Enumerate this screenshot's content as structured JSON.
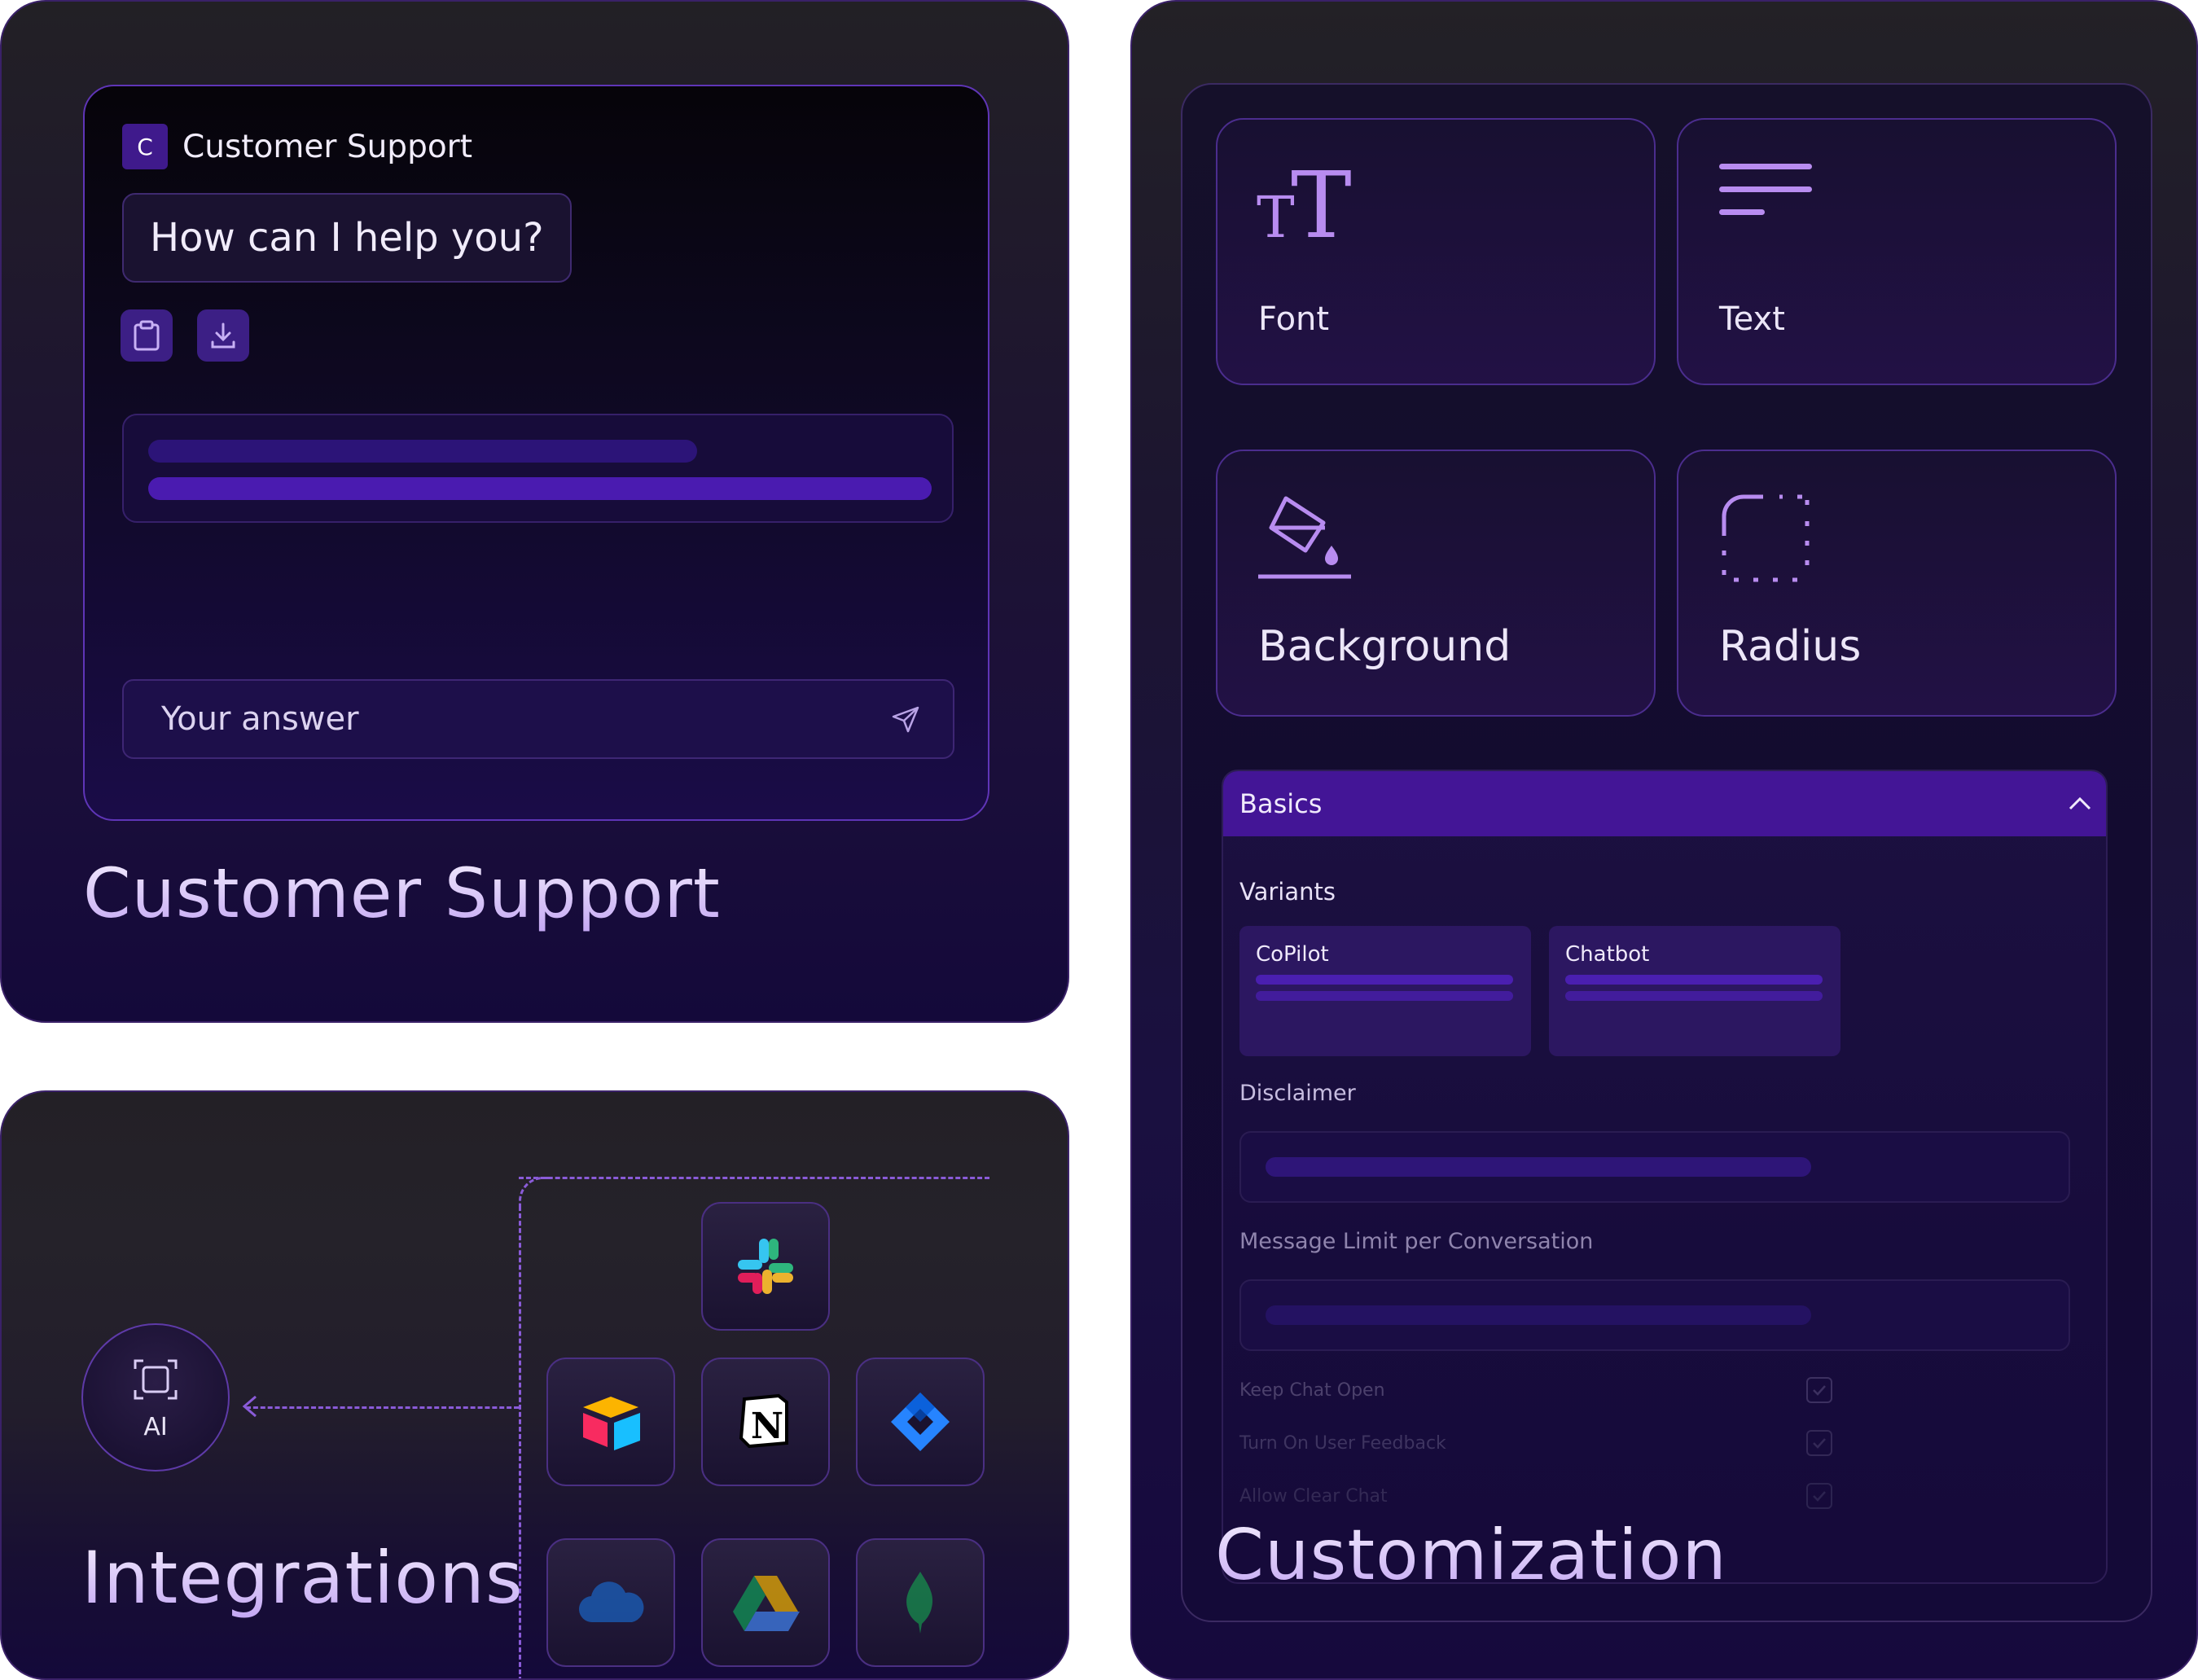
{
  "support": {
    "chat_title": "Customer Support",
    "logo_letter": "C",
    "greeting": "How can I help you?",
    "input_placeholder": "Your answer",
    "panel_title": "Customer Support"
  },
  "integrations": {
    "panel_title": "Integrations",
    "ai_label": "AI",
    "apps": [
      "slack-icon",
      "airtable-icon",
      "notion-icon",
      "jira-icon",
      "onedrive-icon",
      "google-drive-icon",
      "mongodb-icon"
    ],
    "notion_letter": "N"
  },
  "customization": {
    "panel_title": "Customization",
    "options": {
      "font": "Font",
      "text": "Text",
      "background": "Background",
      "radius": "Radius"
    },
    "basics": {
      "header": "Basics",
      "variants_label": "Variants",
      "variants": [
        "CoPilot",
        "Chatbot"
      ],
      "disclaimer_label": "Disclaimer",
      "message_limit_label": "Message Limit per Conversation",
      "checkboxes": [
        "Keep Chat Open",
        "Turn On User Feedback",
        "Allow Clear Chat"
      ]
    }
  },
  "colors": {
    "accent": "#431596",
    "bar_primary": "#4a1bb0",
    "bar_secondary": "#2c1478"
  }
}
